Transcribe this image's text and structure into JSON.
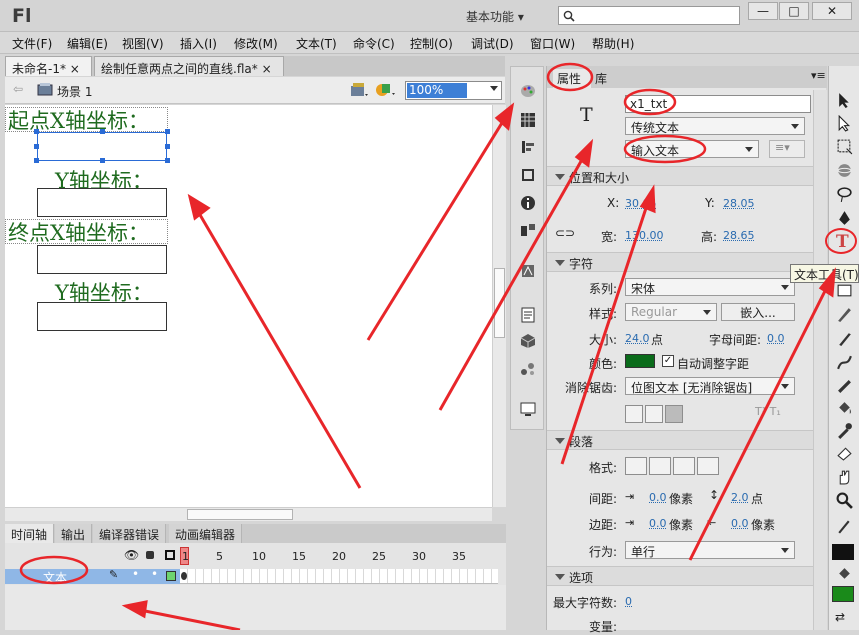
{
  "app": {
    "logo": "Fl",
    "workspace": "基本功能",
    "search_placeholder": ""
  },
  "window_controls": {
    "minimize": "—",
    "maximize": "□",
    "close": "✕"
  },
  "menu": [
    "文件(F)",
    "编辑(E)",
    "视图(V)",
    "插入(I)",
    "修改(M)",
    "文本(T)",
    "命令(C)",
    "控制(O)",
    "调试(D)",
    "窗口(W)",
    "帮助(H)"
  ],
  "doc_tabs": [
    {
      "label": "未命名-1*",
      "close": "×"
    },
    {
      "label": "绘制任意两点之间的直线.fla*",
      "close": "×"
    }
  ],
  "scene": {
    "label": "场景 1",
    "zoom": "100%"
  },
  "stage": {
    "label_start_x": "起点X轴坐标：",
    "label_y1": "Y轴坐标：",
    "label_end_x": "终点X轴坐标：",
    "label_y2": "Y轴坐标："
  },
  "timeline": {
    "tabs": [
      "时间轴",
      "输出",
      "编译器错误",
      "动画编辑器"
    ],
    "frame_numbers": [
      "1",
      "5",
      "10",
      "15",
      "20",
      "25",
      "30",
      "35"
    ],
    "layer_name": "文本"
  },
  "properties": {
    "tabs": [
      "属性",
      "库"
    ],
    "instance_name": "x1_txt",
    "text_engine": "传统文本",
    "text_type": "输入文本",
    "section_position": "位置和大小",
    "x_label": "X:",
    "x_value": "30.05",
    "y_label": "Y:",
    "y_value": "28.05",
    "w_label": "宽:",
    "w_value": "130.00",
    "h_label": "高:",
    "h_value": "28.65",
    "section_char": "字符",
    "family_label": "系列:",
    "family_value": "宋体",
    "style_label": "样式:",
    "style_value": "Regular",
    "embed_label": "嵌入...",
    "size_label": "大小:",
    "size_value": "24.0",
    "size_unit": "点",
    "spacing_label": "字母间距:",
    "spacing_value": "0.0",
    "color_label": "颜色:",
    "autokern_label": "自动调整字距",
    "aa_label": "消除锯齿:",
    "aa_value": "位图文本 [无消除锯齿]",
    "section_para": "段落",
    "format_label": "格式:",
    "gap_label": "间距:",
    "gap_indent": "0.0",
    "gap_unit": "像素",
    "line_gap": "2.0",
    "line_gap_unit": "点",
    "margin_label": "边距:",
    "margin_left": "0.0",
    "margin_unit": "像素",
    "margin_right": "0.0",
    "margin_right_unit": "像素",
    "behavior_label": "行为:",
    "behavior_value": "单行",
    "section_options": "选项",
    "maxchars_label": "最大字符数:",
    "maxchars_value": "0",
    "var_label": "变量:"
  },
  "tooltip": {
    "text_tool": "文本工具(T)"
  },
  "colors": {
    "label_green": "#1f6b1f",
    "annotation_red": "#e8262a",
    "selection_blue": "#2a6bd6",
    "text_color_swatch": "#0a6b1a",
    "fill_swatch": "#1a8a1a"
  }
}
